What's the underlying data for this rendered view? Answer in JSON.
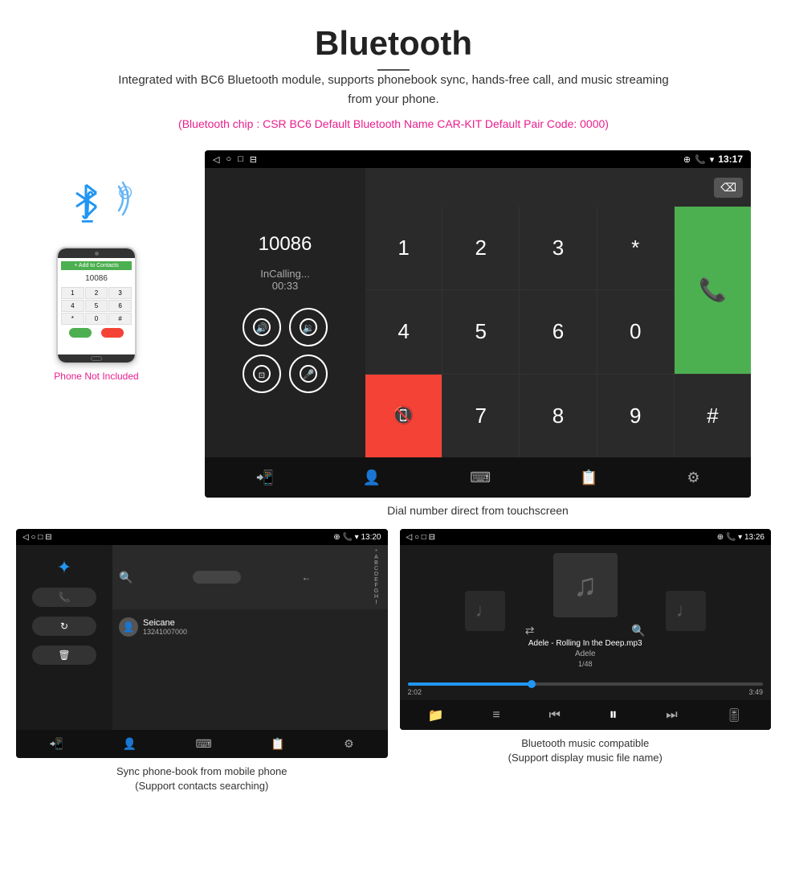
{
  "header": {
    "title": "Bluetooth",
    "description": "Integrated with BC6 Bluetooth module, supports phonebook sync, hands-free call, and music streaming from your phone.",
    "specs": "(Bluetooth chip : CSR BC6    Default Bluetooth Name CAR-KIT    Default Pair Code: 0000)"
  },
  "phone_illustration": {
    "label": "Phone Not Included"
  },
  "main_screen": {
    "status_time": "13:17",
    "dial_number": "10086",
    "calling_status": "InCalling...",
    "timer": "00:33",
    "numpad_keys": [
      "1",
      "2",
      "3",
      "*",
      "4",
      "5",
      "6",
      "0",
      "7",
      "8",
      "9",
      "#"
    ],
    "caption": "Dial number direct from touchscreen"
  },
  "phonebook_screen": {
    "status_time": "13:20",
    "contact_name": "Seicane",
    "contact_number": "13241007000",
    "alphabet": [
      "A",
      "B",
      "C",
      "D",
      "E",
      "F",
      "G",
      "H",
      "I"
    ],
    "caption": "Sync phone-book from mobile phone",
    "sub_caption": "(Support contacts searching)"
  },
  "music_screen": {
    "status_time": "13:26",
    "track_name": "Adele - Rolling In the Deep.mp3",
    "artist": "Adele",
    "track_count": "1/48",
    "time_current": "2:02",
    "time_total": "3:49",
    "progress_percent": 35,
    "caption": "Bluetooth music compatible",
    "sub_caption": "(Support display music file name)"
  }
}
